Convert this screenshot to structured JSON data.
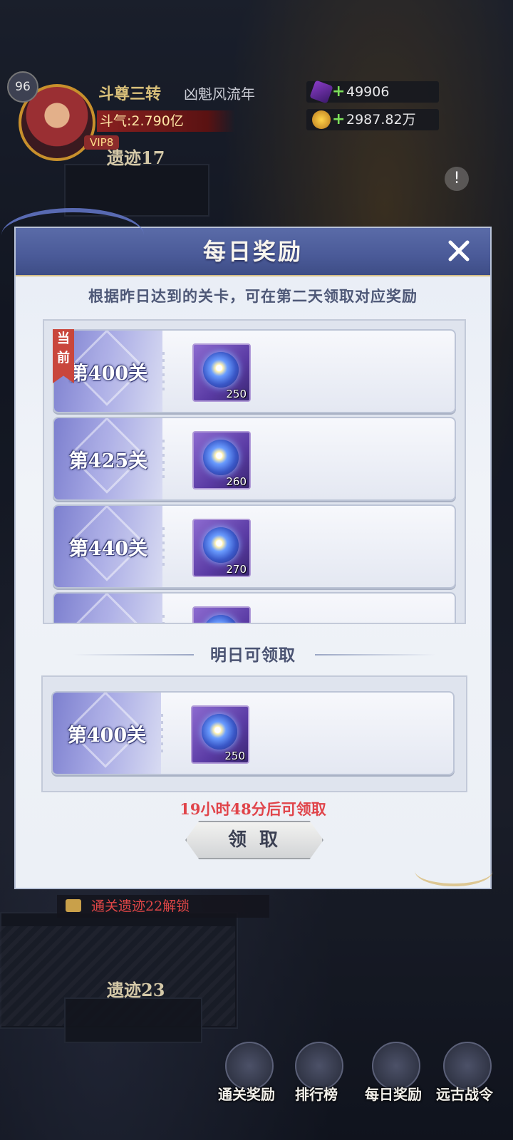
{
  "hud": {
    "level": "96",
    "player_name": "斗尊三转",
    "player_title": "凶魁风流年",
    "power": "斗气:2.790亿",
    "vip": "VIP8",
    "gems": "49906",
    "gold": "2987.82万"
  },
  "scene": {
    "stage_top": "遗迹17",
    "stage_bottom": "遗迹23",
    "lock_text": "通关遗迹22解锁",
    "bubble": "!"
  },
  "bottom_nav": [
    {
      "label": "通关奖励",
      "icon": "reward-icon"
    },
    {
      "label": "排行榜",
      "icon": "rank-icon"
    },
    {
      "label": "每日奖励",
      "icon": "daily-reward-icon"
    },
    {
      "label": "远古战令",
      "icon": "battle-pass-icon"
    }
  ],
  "modal": {
    "title": "每日奖励",
    "subtitle": "根据昨日达到的关卡，可在第二天领取对应奖励",
    "current_tag_1": "当",
    "current_tag_2": "前",
    "rows": [
      {
        "stage": "第400关",
        "count": "250",
        "item_icon": "star-orb-icon"
      },
      {
        "stage": "第425关",
        "count": "260",
        "item_icon": "star-orb-icon"
      },
      {
        "stage": "第440关",
        "count": "270",
        "item_icon": "star-orb-icon"
      },
      {
        "stage": "",
        "count": "",
        "item_icon": "star-orb-icon"
      }
    ],
    "tomorrow_header": "明日可领取",
    "tomorrow_row": {
      "stage": "第400关",
      "count": "250",
      "item_icon": "star-orb-icon"
    },
    "countdown": "19小时48分后可领取",
    "claim_label": "领取"
  },
  "colors": {
    "header": "#4a5a98",
    "countdown": "#e0444a",
    "current_tag": "#c9463c"
  }
}
